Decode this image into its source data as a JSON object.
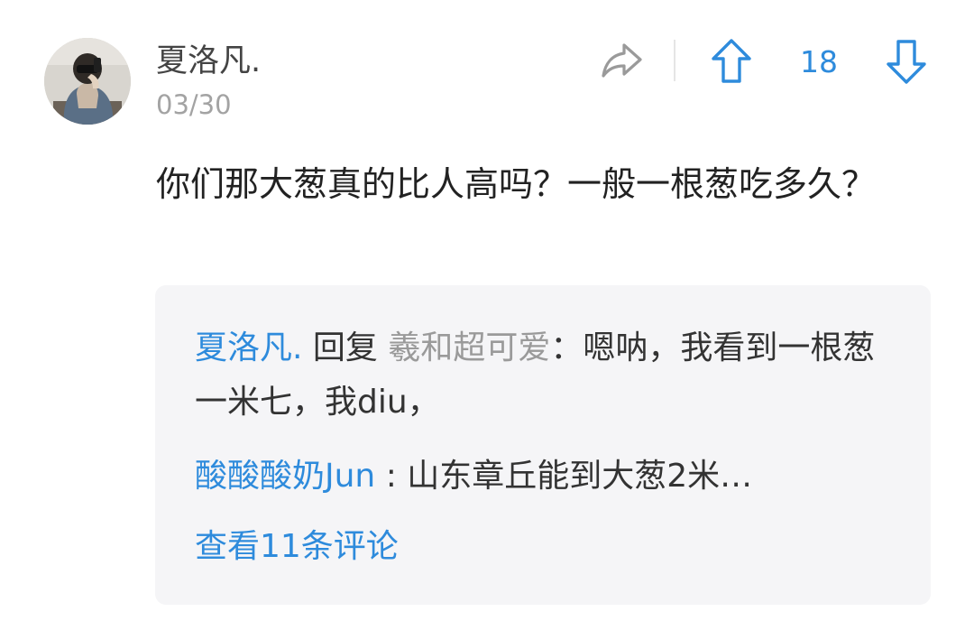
{
  "comment": {
    "username": "夏洛凡.",
    "date": "03/30",
    "body": "你们那大葱真的比人高吗？一般一根葱吃多久？",
    "vote_count": "18"
  },
  "icons": {
    "avatar": "user-avatar",
    "share": "share-arrow-icon",
    "upvote": "arrow-up-icon",
    "downvote": "arrow-down-icon"
  },
  "replies": [
    {
      "author": "夏洛凡.",
      "reply_word": " 回复 ",
      "target": "羲和超可爱",
      "separator": "：",
      "text": "嗯呐，我看到一根葱一米七，我diu，"
    },
    {
      "author": "酸酸酸奶Jun",
      "separator": " : ",
      "text": "山东章丘能到大葱2米…"
    }
  ],
  "view_all_label": "查看11条评论",
  "colors": {
    "accent": "#2e8bdc",
    "reply_background": "#f5f5f7",
    "muted_text": "#a3a3a3",
    "body_text": "#222222"
  }
}
